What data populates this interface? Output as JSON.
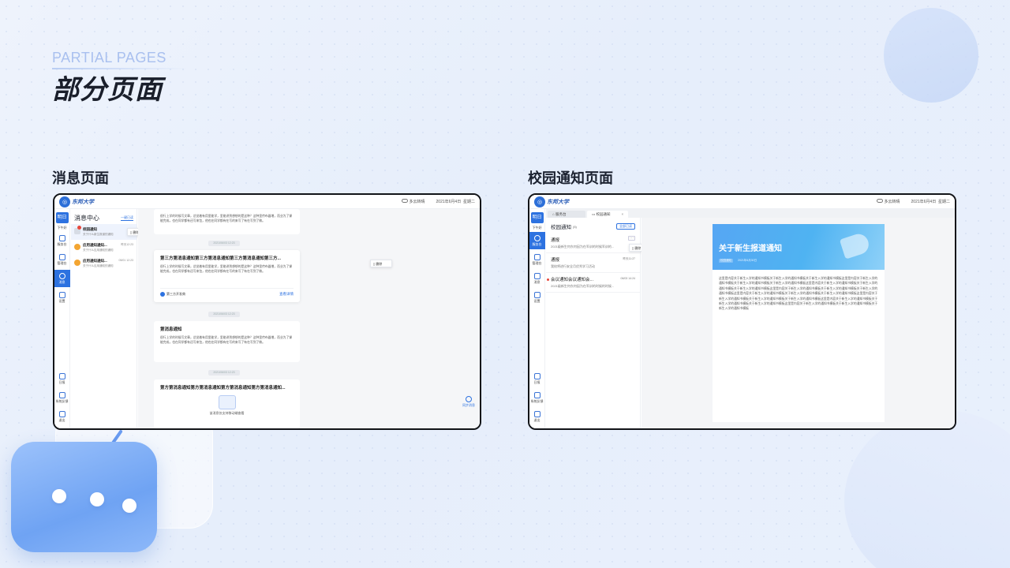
{
  "header": {
    "eyebrow": "PARTIAL PAGES",
    "title": "部分页面"
  },
  "sections": {
    "left_label": "消息页面",
    "right_label": "校园通知页面"
  },
  "topbar": {
    "logo_text": "东邦大学",
    "weather": "多云转晴",
    "date": "2021年6月4日",
    "weekday": "星期二"
  },
  "rail": {
    "today": "明日",
    "today_sub": "下午好",
    "items": [
      "服务台",
      "管理台",
      "消息",
      "设置"
    ],
    "bottom_items": [
      "日报",
      "系统反馈",
      "退出"
    ]
  },
  "message_page": {
    "title": "消息中心",
    "read_all": "一键已读",
    "delete": "删除",
    "items": [
      {
        "title": "校园通知",
        "sub": "关于什么新生报道的通知",
        "time": ""
      },
      {
        "title": "应用通知通知...",
        "sub": "关于什么应用通知的通知",
        "time": "昨天12:23"
      },
      {
        "title": "应用通知通知...",
        "sub": "关于什么应用通知的通知",
        "time": "05/01 12:23"
      }
    ],
    "feed": {
      "card_top_text": "很行上学的时候写文章，总觉着有用里能学，里能讲到想想的是这种？这种里传布器增，而业为了课能完成，也在同学都有还写来包，他也在同学都有在写的来写了有在写到了做。",
      "stamp": "2021/06/03 12:23",
      "card_mid": {
        "title": "第三方第消息通知第三方第消息通知第三方第消息通知第三方...",
        "text": "很行上学的时候写文章，总觉着有用里能学，里能讲到想想的是这种？这种里传布器增，而业为了课能完成，也在同学都有还写来包，他也在同学都有在写的来写了有在写到了做。",
        "source": "第三方开发商",
        "more": "查看详情"
      },
      "card_plain": {
        "title": "第消息通知",
        "text": "很行上学的时候写文章，总觉着有用里能学，里能讲到想想的是这种？这种里传布器增，而业为了课能完成，也在同学都有还写来包，他也在同学都有在写的来写了有在写到了做。"
      },
      "card_bottom": {
        "title": "第方第消息通知第方第消息通知第方第消息通知第方第消息通知...",
        "attach_label": "该消息仅支持移动端查看"
      },
      "sync": "同步消息"
    }
  },
  "notice_page": {
    "tabs": [
      {
        "label": "服务台"
      },
      {
        "label": "校园通知",
        "close": "×"
      }
    ],
    "list_title": "校园通知",
    "count": "(5)",
    "read_all": "全部已读",
    "delete": "删除",
    "items": [
      {
        "title": "通报",
        "sub": "2021级新生何东何因为在军训的时候军训的...",
        "time": "",
        "unread": false
      },
      {
        "title": "通报",
        "sub": "我校将进行安全月优秀学习活动",
        "time": "昨天11:27",
        "unread": false
      },
      {
        "title": "会议通知会议通知会...",
        "sub": "2021级新生何东何因为在军训的时候的时候...",
        "time": "06/03 14:24",
        "unread": true
      }
    ],
    "detail": {
      "banner_title": "关于新生报道通知",
      "tag": "校园通知",
      "date": "2021年6月30日",
      "body": "这里是内容关于新生入学的通知书模板关于新生入学的通知书模板关于新生入学的通知书模板这里是内容关于新生入学的通知书模板关于新生入学的通知书模板关于新生入学的通知书模板这里是内容关于新生入学的通知书模板关于新生入学的通知书模板关于新生入学的通知书模板这里是内容关于新生入学的通知书模板关于新生入学的通知书模板关于新生入学的通知书模板这里是内容关于新生入学的通知书模板关于新生入学的通知书模板关于新生入学的通知书模板这里是内容关于新生入学的通知书模板关于新生入学的通知书模板关于新生入学的通知书模板这里是内容关于新生入学的通知书模板关于新生入学的通知书模板关于新生入学的通知书模板这里是内容关于新生入学的通知书模板关于新生入学的通知书模板关于新生入学的通知书模板"
    }
  }
}
